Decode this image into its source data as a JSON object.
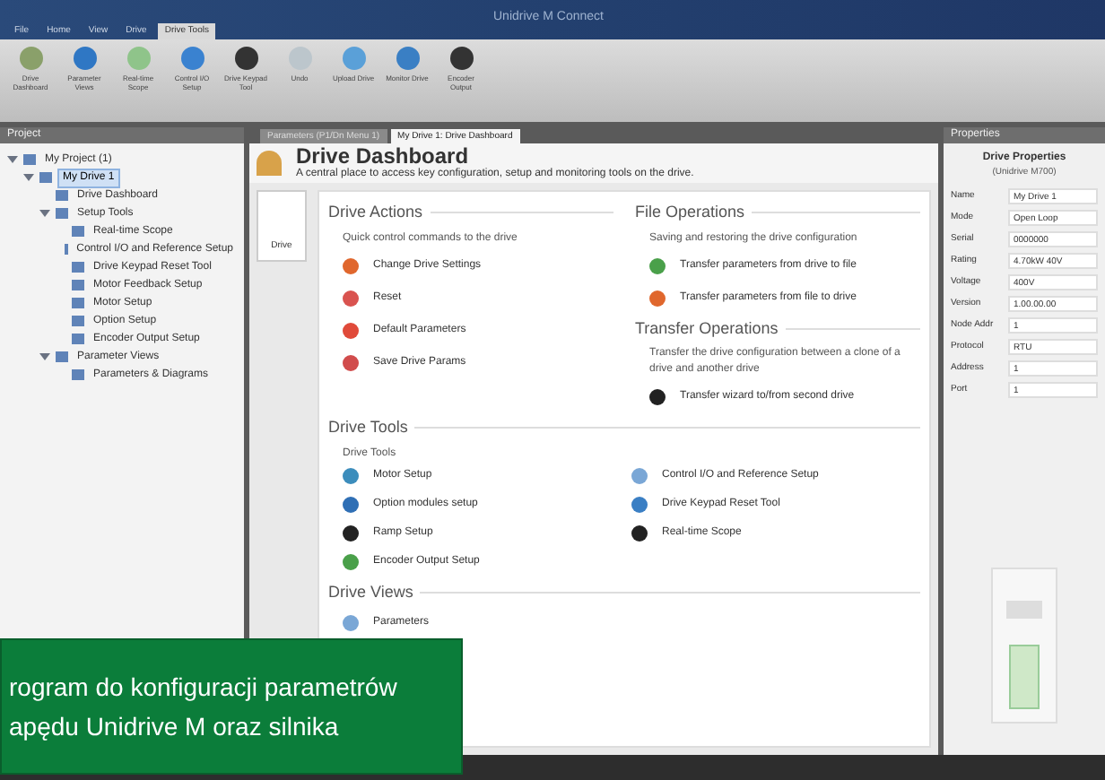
{
  "window": {
    "title": "Unidrive M Connect"
  },
  "ribbon_tabs": [
    {
      "label": "File",
      "selected": false
    },
    {
      "label": "Home",
      "selected": false
    },
    {
      "label": "View",
      "selected": false
    },
    {
      "label": "Drive",
      "selected": false
    },
    {
      "label": "Drive Tools",
      "selected": true
    }
  ],
  "ribbon_buttons": [
    {
      "label": "Drive Dashboard"
    },
    {
      "label": "Parameter Views"
    },
    {
      "label": "Real-time Scope"
    },
    {
      "label": "Control I/O Setup"
    },
    {
      "label": "Drive Keypad Tool"
    },
    {
      "label": "Undo"
    },
    {
      "label": "Upload Drive"
    },
    {
      "label": "Monitor Drive"
    },
    {
      "label": "Encoder Output"
    }
  ],
  "project_panel": {
    "title": "Project",
    "tree": [
      {
        "label": "My Project (1)",
        "expanded": true,
        "selected": false,
        "children": [
          {
            "label": "My Drive 1",
            "expanded": true,
            "selected": true,
            "children": [
              {
                "label": "Drive Dashboard",
                "selected": false
              },
              {
                "label": "Setup Tools",
                "expanded": true,
                "selected": false,
                "children": [
                  {
                    "label": "Real-time Scope",
                    "selected": false
                  },
                  {
                    "label": "Control I/O and Reference Setup",
                    "selected": false
                  },
                  {
                    "label": "Drive Keypad Reset Tool",
                    "selected": false
                  },
                  {
                    "label": "Motor Feedback Setup",
                    "selected": false
                  },
                  {
                    "label": "Motor Setup",
                    "selected": false
                  },
                  {
                    "label": "Option Setup",
                    "selected": false
                  },
                  {
                    "label": "Encoder Output Setup",
                    "selected": false
                  }
                ]
              },
              {
                "label": "Parameter Views",
                "expanded": true,
                "selected": false,
                "children": [
                  {
                    "label": "Parameters & Diagrams",
                    "selected": false
                  }
                ]
              }
            ]
          }
        ]
      }
    ]
  },
  "doc_tabs": [
    {
      "label": "Parameters (P1/Dn Menu 1)",
      "selected": false
    },
    {
      "label": "My Drive 1: Drive Dashboard",
      "selected": true
    }
  ],
  "dashboard": {
    "title": "Drive Dashboard",
    "subtitle": "A central place to access key configuration, setup and monitoring tools on the drive.",
    "side_button": "Drive",
    "drive_actions": {
      "title": "Drive Actions",
      "subtitle": "Quick control commands to the drive",
      "items": [
        "Change Drive Settings",
        "Reset",
        "Default Parameters",
        "Save Drive Params"
      ]
    },
    "file_operations": {
      "title": "File Operations",
      "subtitle": "Saving and restoring the drive configuration",
      "items": [
        "Transfer parameters from drive to file",
        "Transfer parameters from file to drive"
      ]
    },
    "transfer_operations": {
      "title": "Transfer Operations",
      "subtitle": "Transfer the drive configuration between a clone of a drive and another drive",
      "items": [
        "Transfer wizard to/from second drive"
      ]
    },
    "drive_tools": {
      "title": "Drive Tools",
      "subtitle": "Drive Tools",
      "items": [
        "Motor Setup",
        "Option modules setup",
        "Ramp Setup",
        "Encoder Output Setup",
        "Control I/O and Reference Setup",
        "Drive Keypad Reset Tool",
        "Real-time Scope"
      ]
    },
    "drive_views": {
      "title": "Drive Views",
      "items": [
        "Parameters"
      ]
    }
  },
  "properties_panel": {
    "title": "Properties",
    "heading": "Drive Properties",
    "subheading": "(Unidrive M700)",
    "rows": [
      {
        "label": "Name",
        "value": "My Drive 1"
      },
      {
        "label": "Mode",
        "value": "Open Loop"
      },
      {
        "label": "Serial",
        "value": "0000000"
      },
      {
        "label": "Rating",
        "value": "4.70kW 40V"
      },
      {
        "label": "Voltage",
        "value": "400V"
      },
      {
        "label": "Version",
        "value": "1.00.00.00"
      },
      {
        "label": "Node Addr",
        "value": "1"
      },
      {
        "label": "Protocol",
        "value": "RTU"
      },
      {
        "label": "Address",
        "value": "1"
      },
      {
        "label": "Port",
        "value": "1"
      }
    ]
  },
  "caption": {
    "lines": [
      "rogram do konfiguracji parametrów",
      "apędu Unidrive M oraz silnika"
    ]
  }
}
